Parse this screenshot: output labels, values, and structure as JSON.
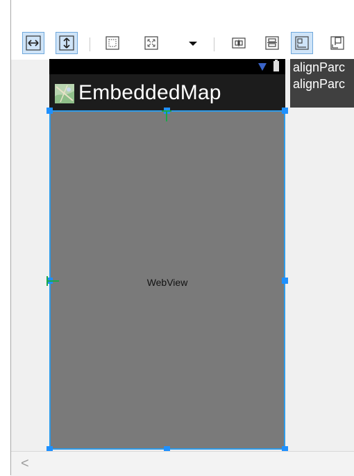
{
  "toolbar": {
    "buttons": [
      {
        "name": "fill-width-button",
        "icon": "horizontal-arrows-icon",
        "active": true
      },
      {
        "name": "fill-height-button",
        "icon": "vertical-arrows-icon",
        "active": true
      },
      {
        "name": "margins-button",
        "icon": "dotted-square-icon",
        "active": false
      },
      {
        "name": "zoom-fit-button",
        "icon": "expand-square-icon",
        "active": false
      },
      {
        "name": "more-dropdown",
        "icon": "caret-down-icon",
        "active": false
      },
      {
        "name": "center-horizontal-button",
        "icon": "center-horizontal-icon",
        "active": false
      },
      {
        "name": "center-vertical-button",
        "icon": "center-vertical-icon",
        "active": false
      },
      {
        "name": "align-parent-button",
        "icon": "align-parent-icon",
        "active": true
      },
      {
        "name": "align-other-button",
        "icon": "align-other-icon",
        "active": false
      }
    ]
  },
  "app": {
    "title": "EmbeddedMap",
    "icon": "map-app-icon"
  },
  "webview": {
    "label": "WebView"
  },
  "hints": [
    "alignParc",
    "alignParc"
  ],
  "scrollbar": {
    "left_arrow": "<"
  },
  "colors": {
    "selection_blue": "#2f9be8",
    "anchor_green": "#1aa84a",
    "phone_gray": "#7a7a7a",
    "active_button_bg": "#cfe4f8"
  }
}
